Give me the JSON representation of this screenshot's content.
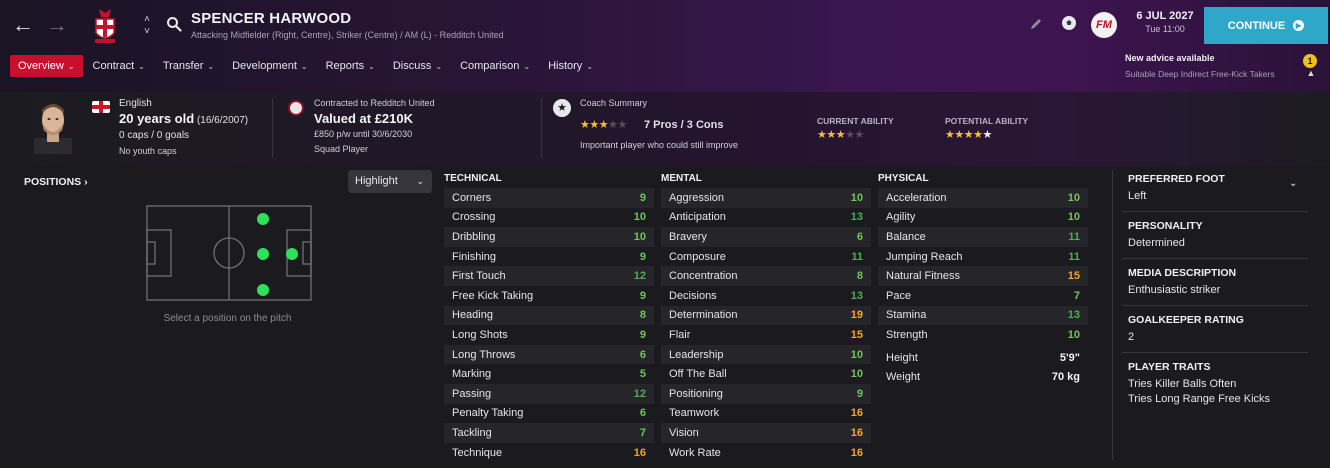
{
  "header": {
    "player_name": "SPENCER HARWOOD",
    "player_subtitle": "Attacking Midfielder (Right, Centre), Striker (Centre) / AM (L) - Redditch United",
    "date": "6 JUL 2027",
    "time": "Tue 11:00",
    "continue_label": "CONTINUE",
    "fm_logo": "FM",
    "advice_title": "New advice available",
    "advice_sub": "Suitable Deep Indirect Free-Kick Takers",
    "advice_badge": "1",
    "accent_color": "#c8102e",
    "continue_color": "#2fa7c8"
  },
  "tabs": [
    {
      "label": "Overview",
      "active": true
    },
    {
      "label": "Contract",
      "active": false
    },
    {
      "label": "Transfer",
      "active": false
    },
    {
      "label": "Development",
      "active": false
    },
    {
      "label": "Reports",
      "active": false
    },
    {
      "label": "Discuss",
      "active": false
    },
    {
      "label": "Comparison",
      "active": false
    },
    {
      "label": "History",
      "active": false
    }
  ],
  "info": {
    "nationality": "English",
    "age": "20 years old",
    "dob": "(16/6/2007)",
    "caps": "0 caps / 0 goals",
    "youth_caps": "No youth caps",
    "contract_line": "Contracted to Redditch United",
    "value": "Valued at £210K",
    "wage": "£850 p/w until 30/6/2030",
    "squad_status": "Squad Player",
    "coach_summary_title": "Coach Summary",
    "coach_stars": 3,
    "pros_cons": "7 Pros / 3 Cons",
    "coach_note": "Important player who could still improve",
    "current_ability_label": "CURRENT ABILITY",
    "current_ability_stars": 3,
    "potential_ability_label": "POTENTIAL ABILITY",
    "potential_ability_stars": 4.5
  },
  "positions": {
    "title": "POSITIONS",
    "highlight_label": "Highlight",
    "hint": "Select a position on the pitch",
    "dot_color": "#2ee05a"
  },
  "attributes": {
    "technical": {
      "title": "TECHNICAL",
      "rows": [
        {
          "name": "Corners",
          "value": "9"
        },
        {
          "name": "Crossing",
          "value": "10"
        },
        {
          "name": "Dribbling",
          "value": "10"
        },
        {
          "name": "Finishing",
          "value": "9"
        },
        {
          "name": "First Touch",
          "value": "12"
        },
        {
          "name": "Free Kick Taking",
          "value": "9"
        },
        {
          "name": "Heading",
          "value": "8"
        },
        {
          "name": "Long Shots",
          "value": "9"
        },
        {
          "name": "Long Throws",
          "value": "6"
        },
        {
          "name": "Marking",
          "value": "5"
        },
        {
          "name": "Passing",
          "value": "12"
        },
        {
          "name": "Penalty Taking",
          "value": "6"
        },
        {
          "name": "Tackling",
          "value": "7"
        },
        {
          "name": "Technique",
          "value": "16"
        }
      ]
    },
    "mental": {
      "title": "MENTAL",
      "rows": [
        {
          "name": "Aggression",
          "value": "10"
        },
        {
          "name": "Anticipation",
          "value": "13"
        },
        {
          "name": "Bravery",
          "value": "6"
        },
        {
          "name": "Composure",
          "value": "11"
        },
        {
          "name": "Concentration",
          "value": "8"
        },
        {
          "name": "Decisions",
          "value": "13"
        },
        {
          "name": "Determination",
          "value": "19"
        },
        {
          "name": "Flair",
          "value": "15"
        },
        {
          "name": "Leadership",
          "value": "10"
        },
        {
          "name": "Off The Ball",
          "value": "10"
        },
        {
          "name": "Positioning",
          "value": "9"
        },
        {
          "name": "Teamwork",
          "value": "16"
        },
        {
          "name": "Vision",
          "value": "16"
        },
        {
          "name": "Work Rate",
          "value": "16"
        }
      ]
    },
    "physical": {
      "title": "PHYSICAL",
      "rows": [
        {
          "name": "Acceleration",
          "value": "10"
        },
        {
          "name": "Agility",
          "value": "10"
        },
        {
          "name": "Balance",
          "value": "11"
        },
        {
          "name": "Jumping Reach",
          "value": "11"
        },
        {
          "name": "Natural Fitness",
          "value": "15"
        },
        {
          "name": "Pace",
          "value": "7"
        },
        {
          "name": "Stamina",
          "value": "13"
        },
        {
          "name": "Strength",
          "value": "10"
        }
      ],
      "height_label": "Height",
      "height": "5'9\"",
      "weight_label": "Weight",
      "weight": "70 kg"
    }
  },
  "side": {
    "preferred_foot_title": "PREFERRED FOOT",
    "preferred_foot": "Left",
    "personality_title": "PERSONALITY",
    "personality": "Determined",
    "media_title": "MEDIA DESCRIPTION",
    "media": "Enthusiastic striker",
    "gk_title": "GOALKEEPER RATING",
    "gk": "2",
    "traits_title": "PLAYER TRAITS",
    "traits": [
      "Tries Killer Balls Often",
      "Tries Long Range Free Kicks"
    ]
  }
}
